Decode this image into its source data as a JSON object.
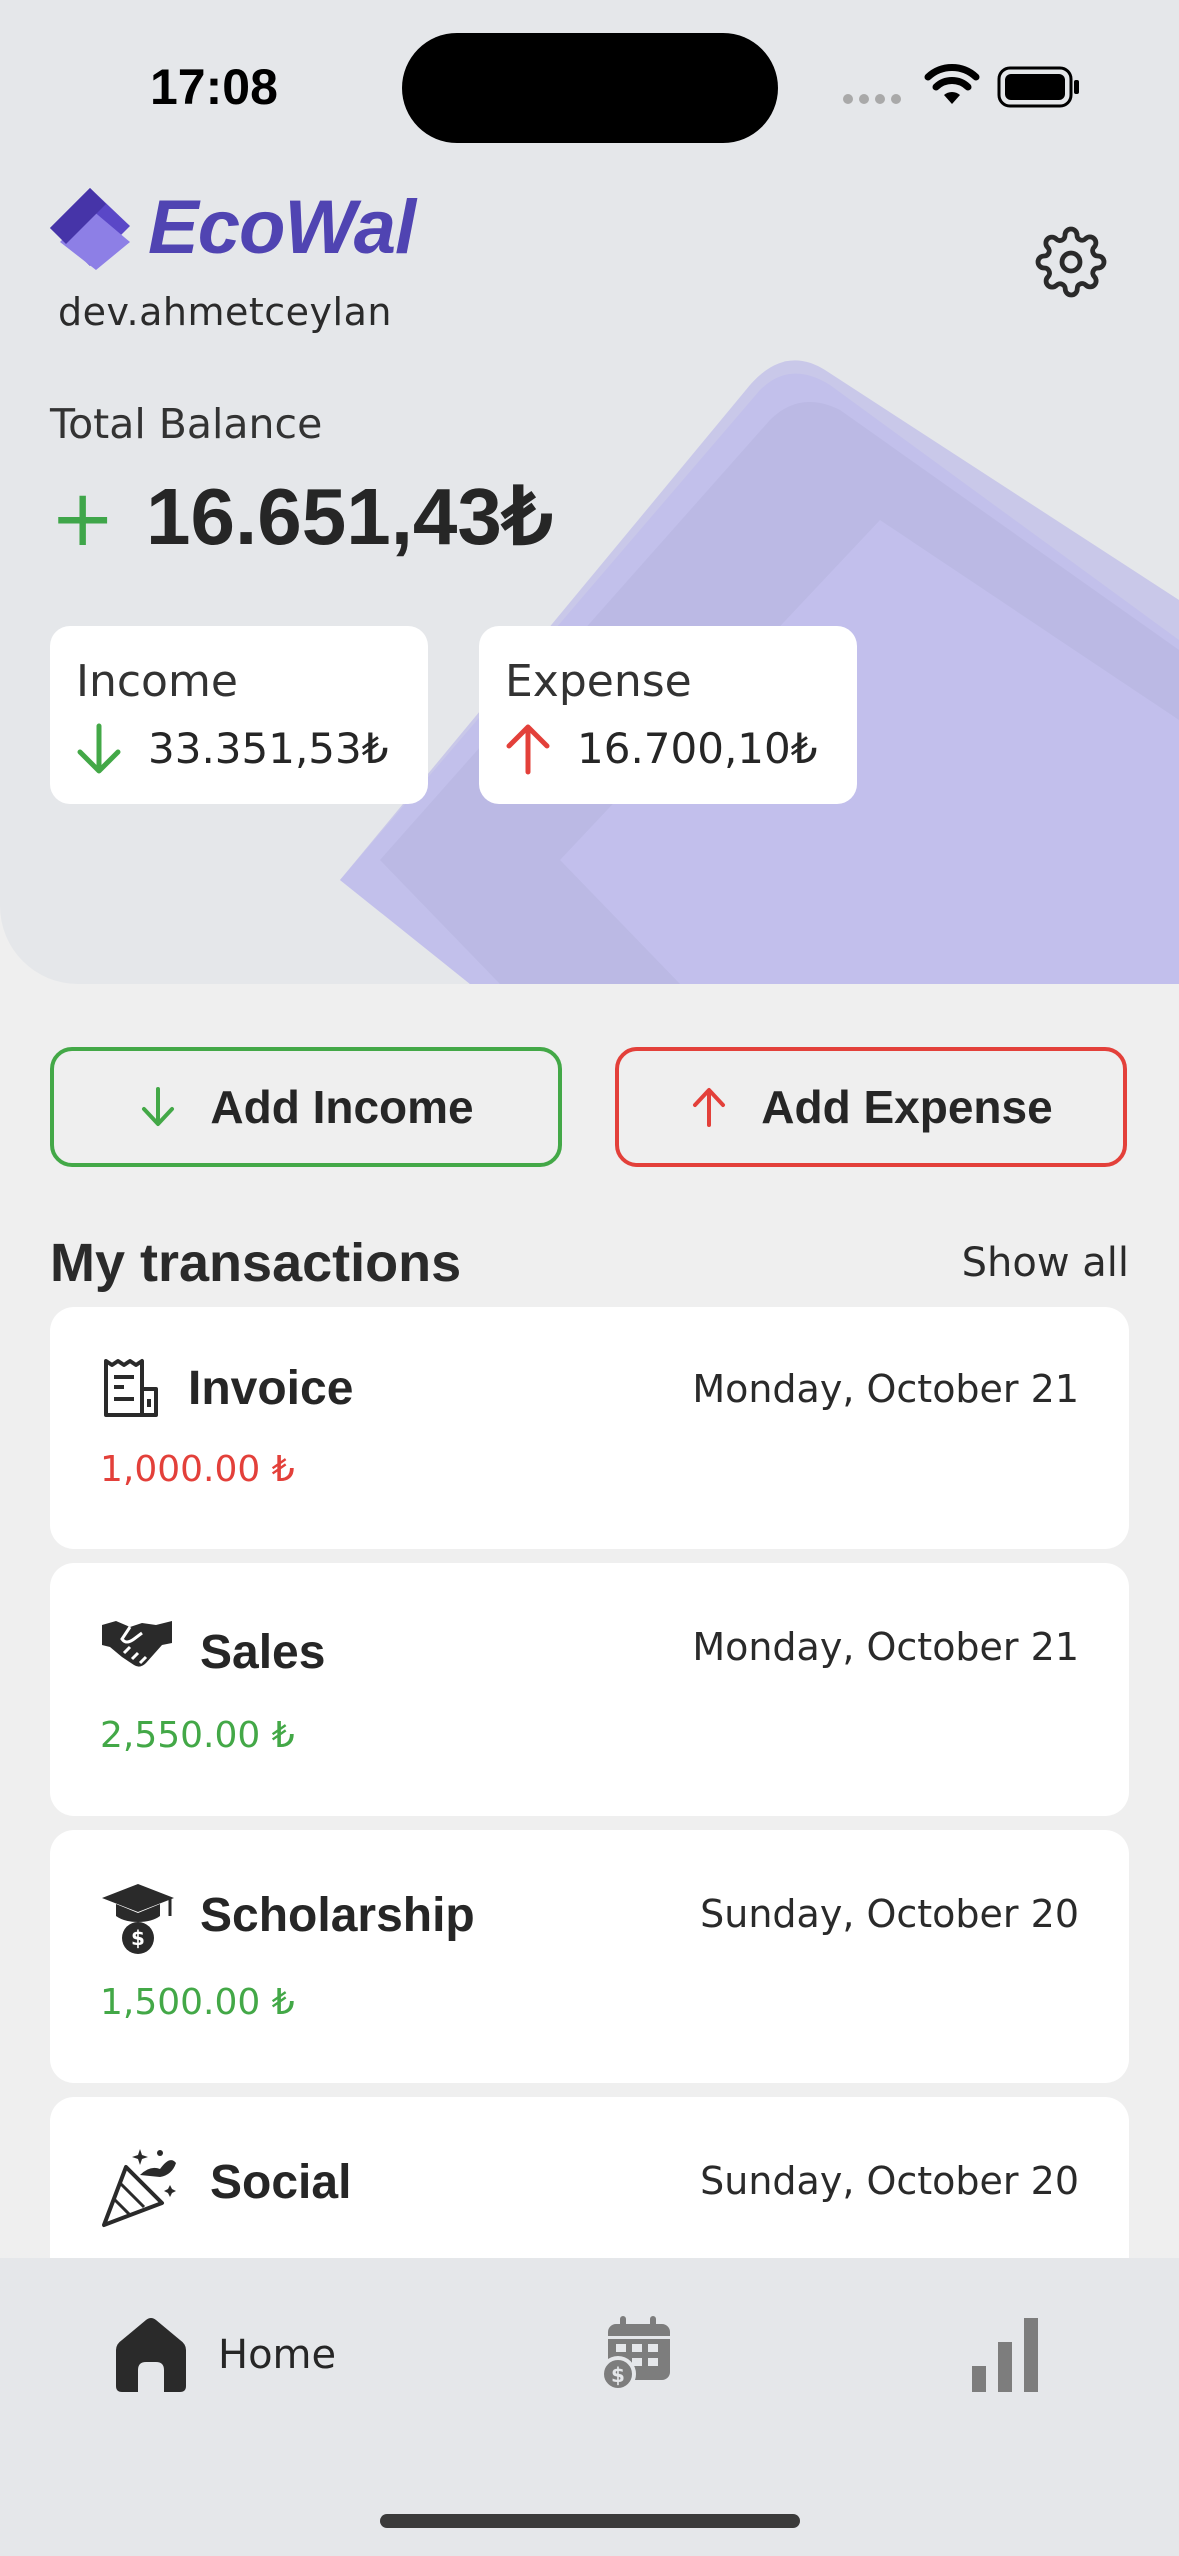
{
  "status_bar": {
    "time": "17:08"
  },
  "app": {
    "name": "EcoWal",
    "username": "dev.ahmetceylan",
    "brand_color": "#5044b2"
  },
  "balance": {
    "label": "Total Balance",
    "sign": "+",
    "amount": "16.651,43₺"
  },
  "summary": {
    "income": {
      "label": "Income",
      "value": "33.351,53₺",
      "icon": "arrow-down-icon"
    },
    "expense": {
      "label": "Expense",
      "value": "16.700,10₺",
      "icon": "arrow-up-icon"
    }
  },
  "actions": {
    "add_income": "Add Income",
    "add_expense": "Add Expense"
  },
  "transactions": {
    "title": "My transactions",
    "show_all": "Show all",
    "items": [
      {
        "name": "Invoice",
        "date": "Monday, October 21",
        "amount": "1,000.00 ₺",
        "type": "expense",
        "icon": "receipt-icon"
      },
      {
        "name": "Sales",
        "date": "Monday, October 21",
        "amount": "2,550.00 ₺",
        "type": "income",
        "icon": "handshake-icon"
      },
      {
        "name": "Scholarship",
        "date": "Sunday, October 20",
        "amount": "1,500.00 ₺",
        "type": "income",
        "icon": "graduation-cap-icon"
      },
      {
        "name": "Social",
        "date": "Sunday, October 20",
        "amount": "",
        "type": "expense",
        "icon": "party-popper-icon"
      }
    ]
  },
  "nav": {
    "home": "Home",
    "calendar_icon": "calendar-money-icon",
    "stats_icon": "bar-chart-icon"
  },
  "colors": {
    "income": "#43a847",
    "expense": "#e3403a",
    "header_bg": "#e5e7ea",
    "page_bg": "#efefef"
  }
}
